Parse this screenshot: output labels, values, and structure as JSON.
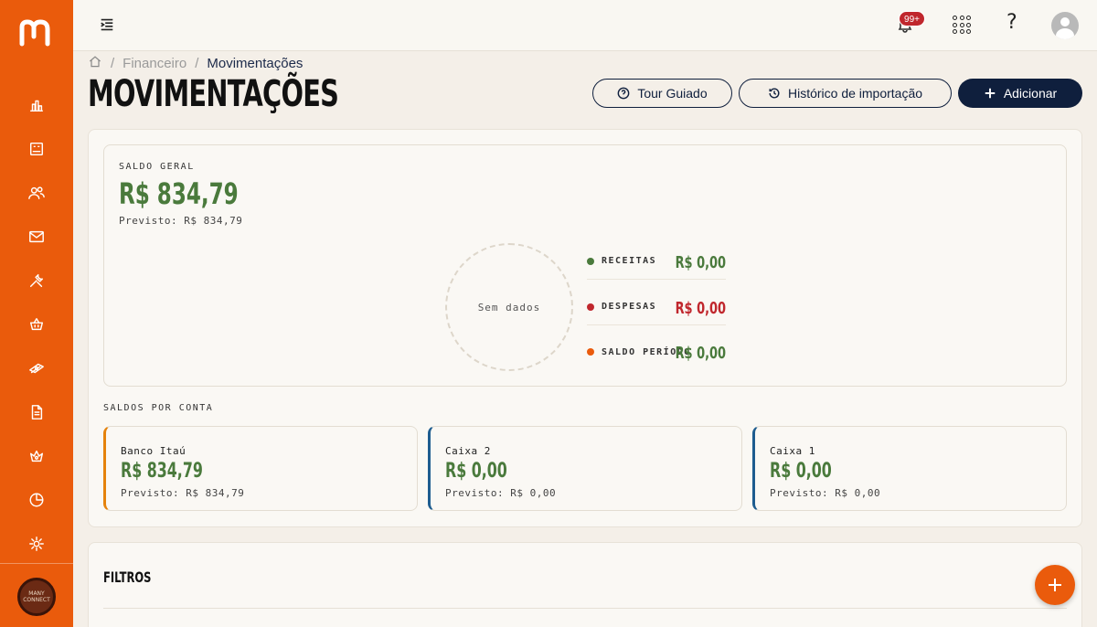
{
  "header": {
    "notifications_badge": "99+",
    "help_label": "?"
  },
  "breadcrumb": {
    "items": [
      "Financeiro",
      "Movimentações"
    ],
    "separator": "/"
  },
  "page": {
    "title": "MOVIMENTAÇÕES"
  },
  "actions": {
    "tour_label": "Tour Guiado",
    "history_label": "Histórico de importação",
    "add_label": "Adicionar"
  },
  "balance": {
    "label": "SALDO GERAL",
    "value": "R$ 834,79",
    "forecast": "Previsto: R$ 834,79",
    "chart_empty": "Sem dados",
    "legend": [
      {
        "label": "RECEITAS",
        "value": "R$ 0,00",
        "color": "#4a7a3c"
      },
      {
        "label": "DESPESAS",
        "value": "R$ 0,00",
        "color": "#c0272d"
      },
      {
        "label": "SALDO PERÍODO",
        "value": "R$ 0,00",
        "color": "#ea5b0c"
      }
    ]
  },
  "accounts": {
    "label": "SALDOS POR CONTA",
    "items": [
      {
        "name": "Banco Itaú",
        "value": "R$ 834,79",
        "forecast": "Previsto: R$ 834,79",
        "accent": "#e5820c"
      },
      {
        "name": "Caixa 2",
        "value": "R$ 0,00",
        "forecast": "Previsto: R$ 0,00",
        "accent": "#1d5c8f"
      },
      {
        "name": "Caixa 1",
        "value": "R$ 0,00",
        "forecast": "Previsto: R$ 0,00",
        "accent": "#1d5c8f"
      }
    ]
  },
  "filters": {
    "title": "FILTROS"
  },
  "sidebar": {
    "org_logo_text": "MANY CONNECT",
    "icons": [
      "dashboard-icon",
      "receipt-icon",
      "users-icon",
      "mail-icon",
      "tools-icon",
      "basket-icon",
      "money-icon",
      "document-icon",
      "crown-icon",
      "pie-chart-icon",
      "settings-icon"
    ]
  },
  "colors": {
    "brand": "#ea5b0c",
    "navy": "#0f1f3d",
    "positive": "#4a7a3c",
    "negative": "#c0272d"
  }
}
